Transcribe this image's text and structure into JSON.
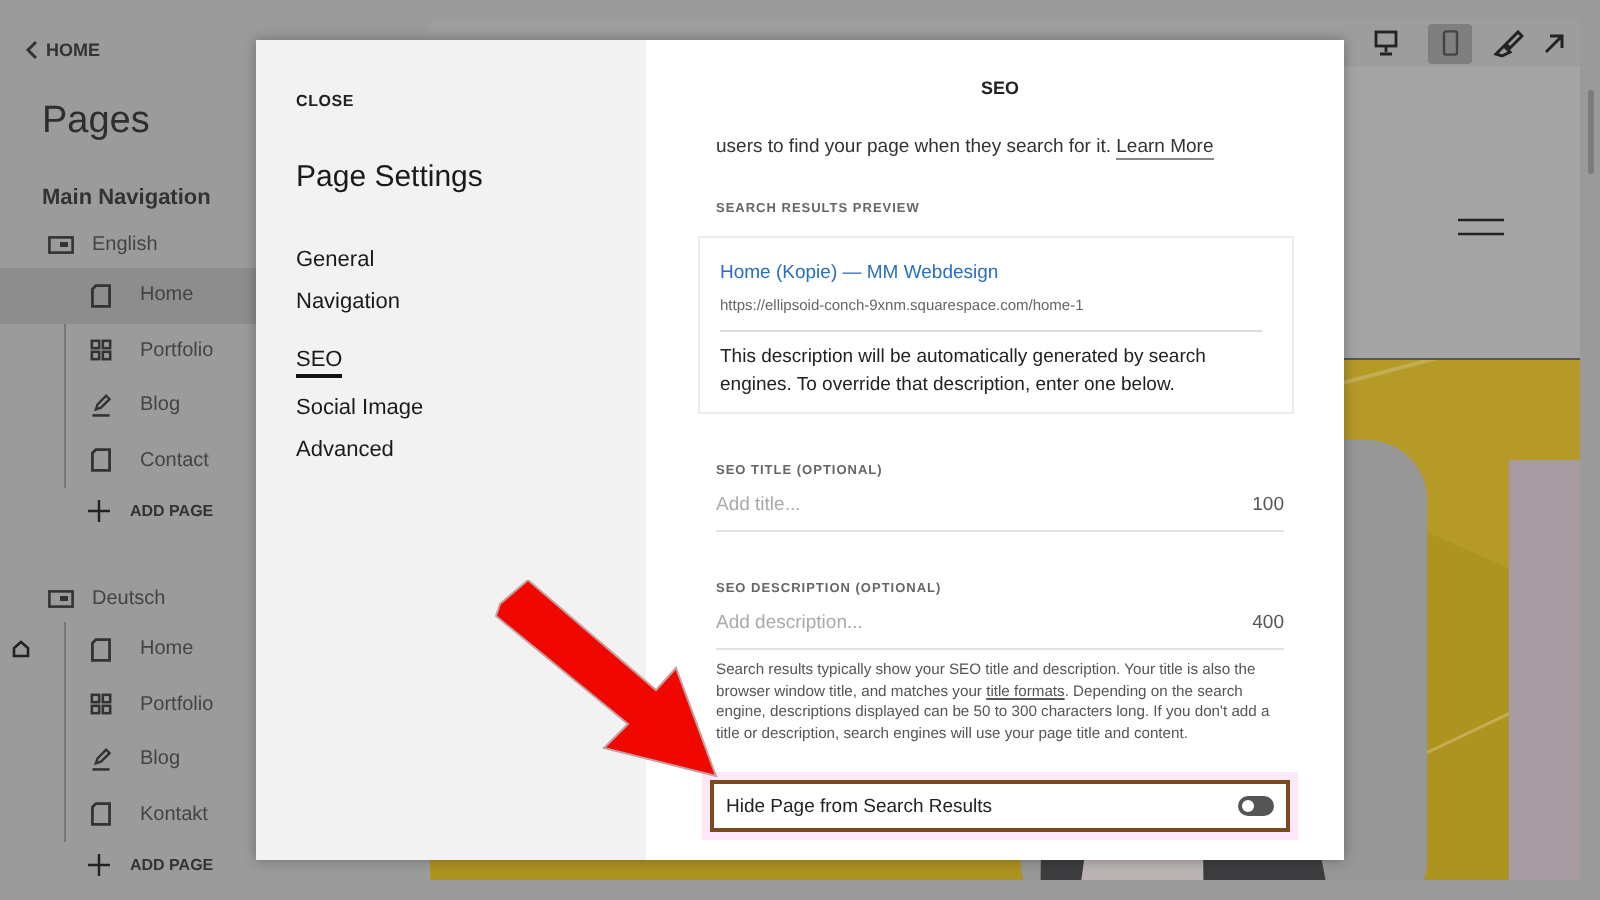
{
  "sidebar": {
    "back": "HOME",
    "title": "Pages",
    "section": "Main Navigation",
    "groups": [
      {
        "label": "English",
        "add": "ADD PAGE",
        "pages": [
          {
            "label": "Home",
            "kind": "page",
            "selected": true,
            "homepage": false
          },
          {
            "label": "Portfolio",
            "kind": "grid",
            "selected": false,
            "homepage": false
          },
          {
            "label": "Blog",
            "kind": "blog",
            "selected": false,
            "homepage": false
          },
          {
            "label": "Contact",
            "kind": "page",
            "selected": false,
            "homepage": false
          }
        ]
      },
      {
        "label": "Deutsch",
        "add": "ADD PAGE",
        "pages": [
          {
            "label": "Home",
            "kind": "page",
            "selected": false,
            "homepage": true
          },
          {
            "label": "Portfolio",
            "kind": "grid",
            "selected": false,
            "homepage": false
          },
          {
            "label": "Blog",
            "kind": "blog",
            "selected": false,
            "homepage": false
          },
          {
            "label": "Kontakt",
            "kind": "page",
            "selected": false,
            "homepage": false
          }
        ]
      }
    ]
  },
  "preview": {
    "devices": [
      {
        "kind": "desktop",
        "selected": false
      },
      {
        "kind": "mobile",
        "selected": true
      }
    ]
  },
  "modal": {
    "close": "CLOSE",
    "title": "Page Settings",
    "nav": [
      {
        "label": "General",
        "selected": false
      },
      {
        "label": "Navigation",
        "selected": false
      },
      {
        "label": "SEO",
        "selected": true
      },
      {
        "label": "Social Image",
        "selected": false
      },
      {
        "label": "Advanced",
        "selected": false
      }
    ],
    "panel_title": "SEO",
    "intro": "users to find your page when they search for it.",
    "intro_link": "Learn More",
    "preview_label": "SEARCH RESULTS PREVIEW",
    "result": {
      "title": "Home (Kopie) — MM Webdesign",
      "url": "https://ellipsoid-conch-9xnm.squarespace.com/home-1",
      "description": "This description will be automatically generated by search engines. To override that description, enter one below."
    },
    "fields": [
      {
        "label": "SEO TITLE (OPTIONAL)",
        "placeholder": "Add title...",
        "counter": "100"
      },
      {
        "label": "SEO DESCRIPTION (OPTIONAL)",
        "placeholder": "Add description...",
        "counter": "400"
      }
    ],
    "help": {
      "before": "Search results typically show your SEO title and description. Your title is also the browser window title, and matches your",
      "link": "title formats",
      "after": ". Depending on the search engine, descriptions displayed can be 50 to 300 characters long. If you don't add a title or description, search engines will use your page title and content."
    },
    "toggle": {
      "label": "Hide Page from Search Results",
      "on": false,
      "highlighted": true
    }
  }
}
